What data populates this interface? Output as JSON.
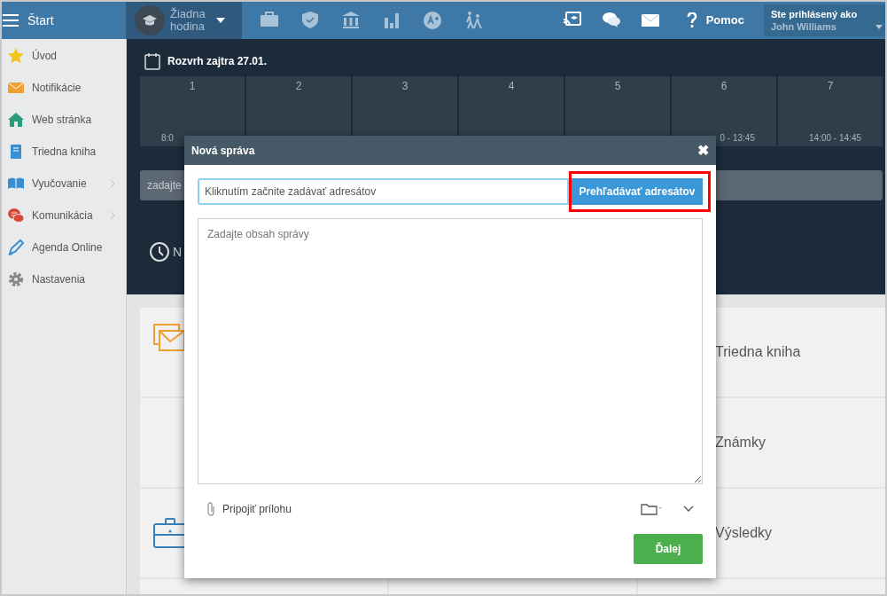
{
  "topbar": {
    "menu_label": "Štart",
    "lesson": {
      "line1": "Žiadna",
      "line2": "hodina"
    },
    "help": "Pomoc",
    "user": {
      "caption": "Ste prihlásený ako",
      "name": "John Williams"
    }
  },
  "sidebar": {
    "items": [
      {
        "label": "Úvod",
        "expandable": false
      },
      {
        "label": "Notifikácie",
        "expandable": false
      },
      {
        "label": "Web stránka",
        "expandable": false
      },
      {
        "label": "Triedna kniha",
        "expandable": false
      },
      {
        "label": "Vyučovanie",
        "expandable": true
      },
      {
        "label": "Komunikácia",
        "expandable": true
      },
      {
        "label": "Agenda Online",
        "expandable": false
      },
      {
        "label": "Nastavenia",
        "expandable": false
      }
    ]
  },
  "schedule": {
    "title": "Rozvrh zajtra 27.01.",
    "periods": [
      {
        "number": "1",
        "time": "8:0"
      },
      {
        "number": "2"
      },
      {
        "number": "3"
      },
      {
        "number": "4"
      },
      {
        "number": "5"
      },
      {
        "number": "6",
        "time": "0 - 13:45"
      },
      {
        "number": "7",
        "time": "14:00 - 14:45"
      }
    ]
  },
  "search": {
    "placeholder": "zadajte"
  },
  "next_lesson": {
    "label": "N"
  },
  "tiles": {
    "items": [
      {
        "label": "Triedna kniha"
      },
      {
        "label": "Známky"
      },
      {
        "label": "Výsledky"
      }
    ]
  },
  "modal": {
    "title": "Nová správa",
    "close": "✖",
    "recipients": {
      "placeholder": "Kliknutím začnite zadávať adresátov"
    },
    "browse_button": "Prehľadávať adresátov",
    "message": {
      "placeholder": "Zadajte obsah správy"
    },
    "attach": "Pripojiť prílohu",
    "next_button": "Ďalej"
  }
}
